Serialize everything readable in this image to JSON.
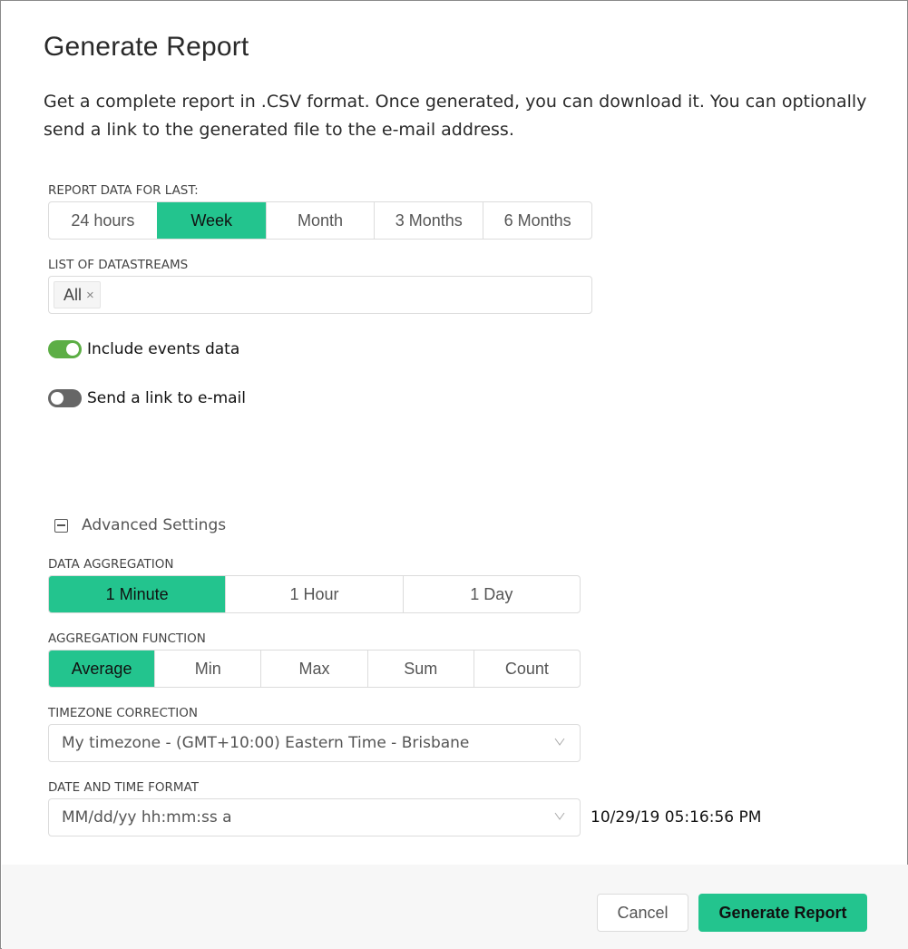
{
  "dialog": {
    "title": "Generate Report",
    "description": "Get a complete report in .CSV format. Once generated, you can download it. You can optionally send a link to the generated file to the e-mail address."
  },
  "period": {
    "label": "REPORT DATA FOR LAST:",
    "options": [
      "24 hours",
      "Week",
      "Month",
      "3 Months",
      "6 Months"
    ],
    "selected": "Week"
  },
  "datastreams": {
    "label": "LIST OF DATASTREAMS",
    "tags": [
      {
        "label": "All",
        "remove_icon": "×"
      }
    ]
  },
  "toggles": {
    "include_events": {
      "label": "Include events data",
      "on": true
    },
    "send_email": {
      "label": "Send a link to e-mail",
      "on": false
    }
  },
  "advanced": {
    "label": "Advanced Settings",
    "icon": "collapse-minus-icon",
    "expanded": true,
    "aggregation": {
      "label": "DATA AGGREGATION",
      "options": [
        "1 Minute",
        "1 Hour",
        "1 Day"
      ],
      "selected": "1 Minute"
    },
    "function": {
      "label": "AGGREGATION FUNCTION",
      "options": [
        "Average",
        "Min",
        "Max",
        "Sum",
        "Count"
      ],
      "selected": "Average"
    },
    "timezone": {
      "label": "TIMEZONE CORRECTION",
      "value": "My timezone - (GMT+10:00) Eastern Time - Brisbane"
    },
    "datetime_format": {
      "label": "DATE AND TIME FORMAT",
      "value": "MM/dd/yy hh:mm:ss a",
      "preview": "10/29/19 05:16:56 PM"
    }
  },
  "footer": {
    "cancel_label": "Cancel",
    "generate_label": "Generate Report"
  },
  "colors": {
    "accent": "#23c48e",
    "toggle_on": "#5cae45",
    "toggle_off": "#666666"
  }
}
